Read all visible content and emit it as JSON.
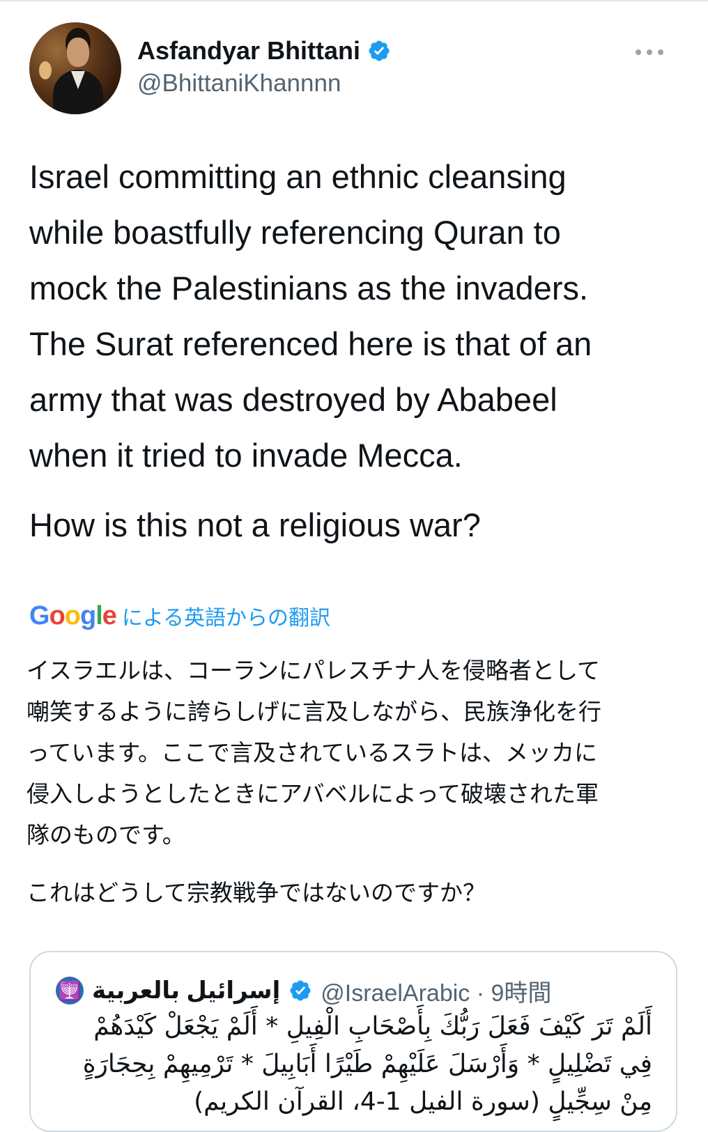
{
  "author": {
    "name": "Asfandyar Bhittani",
    "handle": "@BhittaniKhannnn"
  },
  "tweet": {
    "lines": [
      "Israel committing an ethnic cleansing",
      "while boastfully referencing Quran to",
      "mock the Palestinians as the invaders.",
      "The Surat referenced here is that of an",
      "army that was destroyed by Ababeel",
      "when it tried to invade Mecca."
    ],
    "question": "How is this not a religious war?"
  },
  "translation": {
    "logo_letters": [
      "G",
      "o",
      "o",
      "g",
      "l",
      "e"
    ],
    "attribution": "による英語からの翻訳",
    "lines": [
      "イスラエルは、コーランにパレスチナ人を侵略者として",
      "嘲笑するように誇らしげに言及しながら、民族浄化を行",
      "っています。ここで言及されているスラトは、メッカに",
      "侵入しようとしたときにアバベルによって破壊された軍",
      "隊のものです。"
    ],
    "question": "これはどうして宗教戦争ではないのですか？"
  },
  "quote": {
    "avatar_glyph": "🕎",
    "name": "إسرائيل بالعربية",
    "handle": "@IsraelArabic · 9時間",
    "lines": [
      "أَلَمْ تَرَ كَيْفَ فَعَلَ رَبُّكَ بِأَصْحَابِ الْفِيلِ * أَلَمْ يَجْعَلْ كَيْدَهُمْ",
      "فِي تَضْلِيلٍ * وَأَرْسَلَ عَلَيْهِمْ طَيْرًا أَبَابِيلَ * تَرْمِيهِمْ بِحِجَارَةٍ",
      "مِنْ سِجِّيلٍ (سورة الفيل 1-4، القرآن الكريم)"
    ]
  },
  "colors": {
    "accent": "#1d9bf0",
    "secondary_text": "#536471",
    "primary_text": "#0f1419",
    "border": "#cfd9de"
  },
  "icons": [
    "verified-badge-icon",
    "more-options-icon",
    "google-logo",
    "menorah-avatar-icon"
  ]
}
